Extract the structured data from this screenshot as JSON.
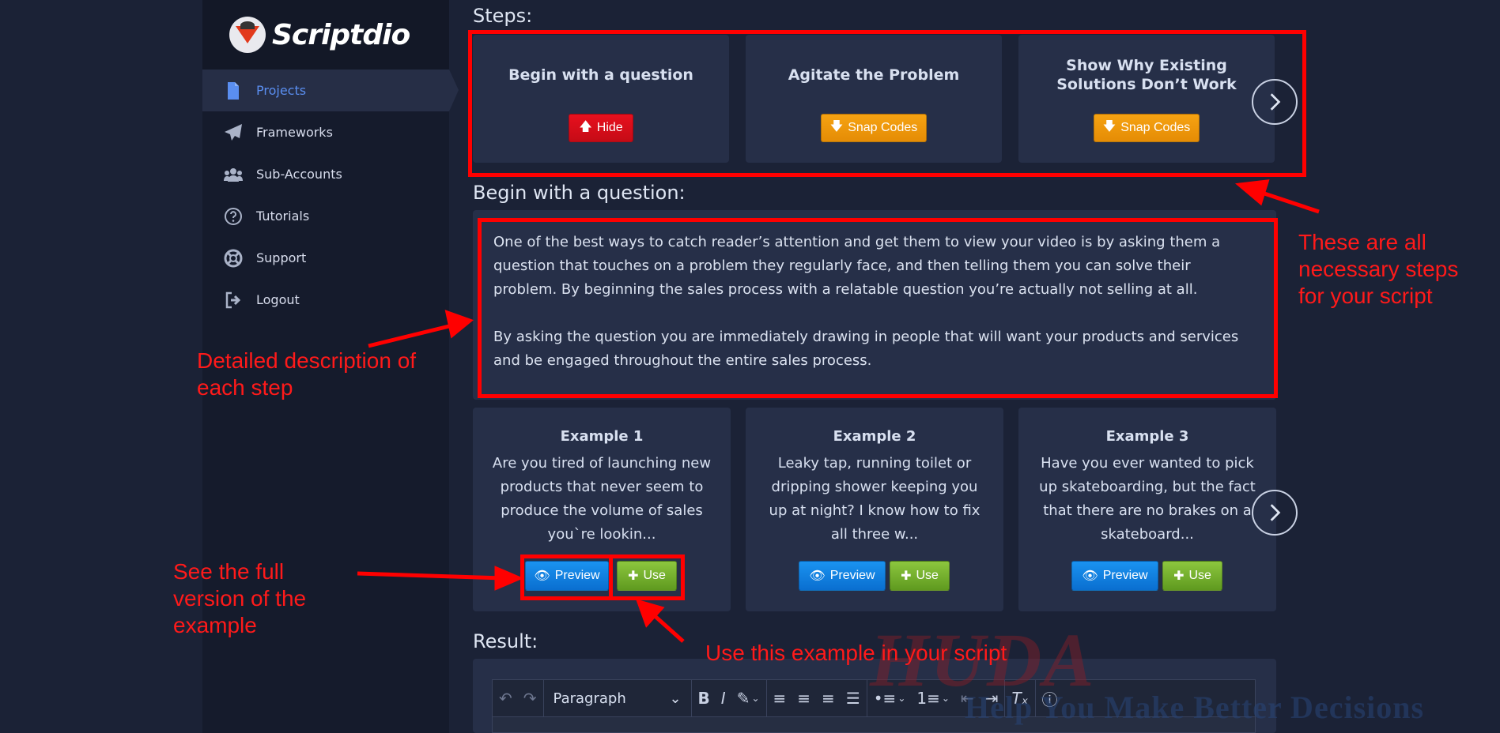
{
  "brand": {
    "name": "Scriptdio"
  },
  "sidebar": {
    "items": [
      {
        "label": "Projects",
        "icon": "file-icon",
        "active": true
      },
      {
        "label": "Frameworks",
        "icon": "paper-plane-icon"
      },
      {
        "label": "Sub-Accounts",
        "icon": "users-icon"
      },
      {
        "label": "Tutorials",
        "icon": "question-circle-icon"
      },
      {
        "label": "Support",
        "icon": "life-ring-icon"
      },
      {
        "label": "Logout",
        "icon": "sign-out-icon"
      }
    ]
  },
  "steps": {
    "heading": "Steps:",
    "items": [
      {
        "title": "Begin with a question",
        "button": "Hide",
        "button_icon": "arrow-up-icon",
        "button_color": "#d90f1c"
      },
      {
        "title": "Agitate the Problem",
        "button": "Snap Codes",
        "button_icon": "arrow-down-icon",
        "button_color": "#f19a0c"
      },
      {
        "title": "Show Why Existing Solutions Don’t Work",
        "button": "Snap Codes",
        "button_icon": "arrow-down-icon",
        "button_color": "#f19a0c"
      }
    ]
  },
  "detail": {
    "heading": "Begin with a question:",
    "paragraphs": [
      "One of the best ways to catch reader’s attention and get them to view your video is by asking them a question that touches on a problem they regularly face, and then telling them you can solve their problem. By beginning the sales process with a relatable question you’re actually not selling at all.",
      "By asking the question you are immediately drawing in people that will want your products and services and be engaged throughout the entire sales process."
    ]
  },
  "examples": {
    "items": [
      {
        "title": "Example 1",
        "text": "Are you tired of launching new products that never seem to produce the volume of sales you`re lookin...",
        "preview": "Preview",
        "use": "Use"
      },
      {
        "title": "Example 2",
        "text": "Leaky tap, running toilet or dripping shower keeping you up at night? I know how to fix all three w...",
        "preview": "Preview",
        "use": "Use"
      },
      {
        "title": "Example 3",
        "text": "Have you ever wanted to pick up skateboarding, but the fact that there are no brakes on a skateboard...",
        "preview": "Preview",
        "use": "Use"
      }
    ]
  },
  "result": {
    "heading": "Result:",
    "toolbar": {
      "block_format": "Paragraph"
    }
  },
  "annotations": {
    "steps_note": "These are all necessary steps for your script",
    "detail_note": "Detailed description of each step",
    "preview_note": "See the full version of the example",
    "use_note": "Use this example in your script"
  },
  "watermark": {
    "top": "HUDA",
    "tagline": "Help You Make Better Decisions"
  },
  "colors": {
    "annotation": "#ff0000",
    "active_nav": "#5a8ef0",
    "background": "#1b2236",
    "sidebar": "#151b2c",
    "card": "#262f48"
  }
}
